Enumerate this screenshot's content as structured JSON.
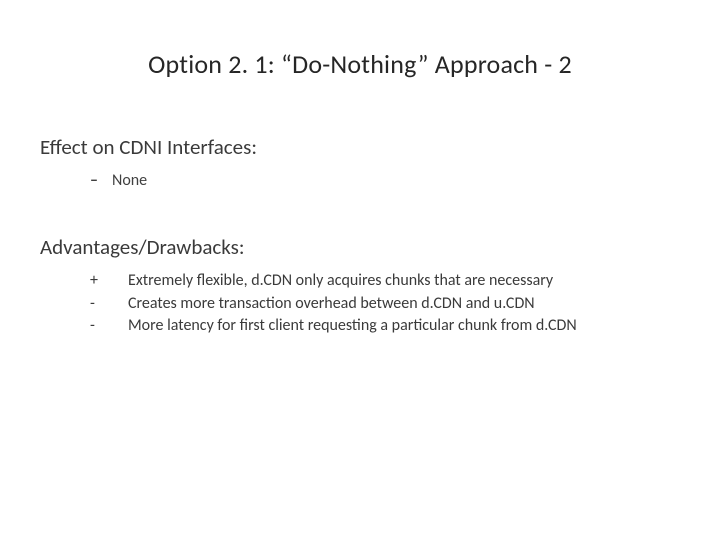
{
  "title": "Option 2. 1: “Do-Nothing” Approach - 2",
  "effect": {
    "heading": "Effect on CDNI Interfaces:",
    "items": [
      {
        "bullet": "–",
        "text": "None"
      }
    ]
  },
  "adv": {
    "heading": "Advantages/Drawbacks:",
    "items": [
      {
        "sign": "+",
        "text": "Extremely flexible, d.CDN only acquires chunks that are necessary"
      },
      {
        "sign": "-",
        "text": "Creates more transaction overhead between d.CDN and u.CDN"
      },
      {
        "sign": "-",
        "text": "More latency for first client requesting a particular chunk from d.CDN"
      }
    ]
  }
}
